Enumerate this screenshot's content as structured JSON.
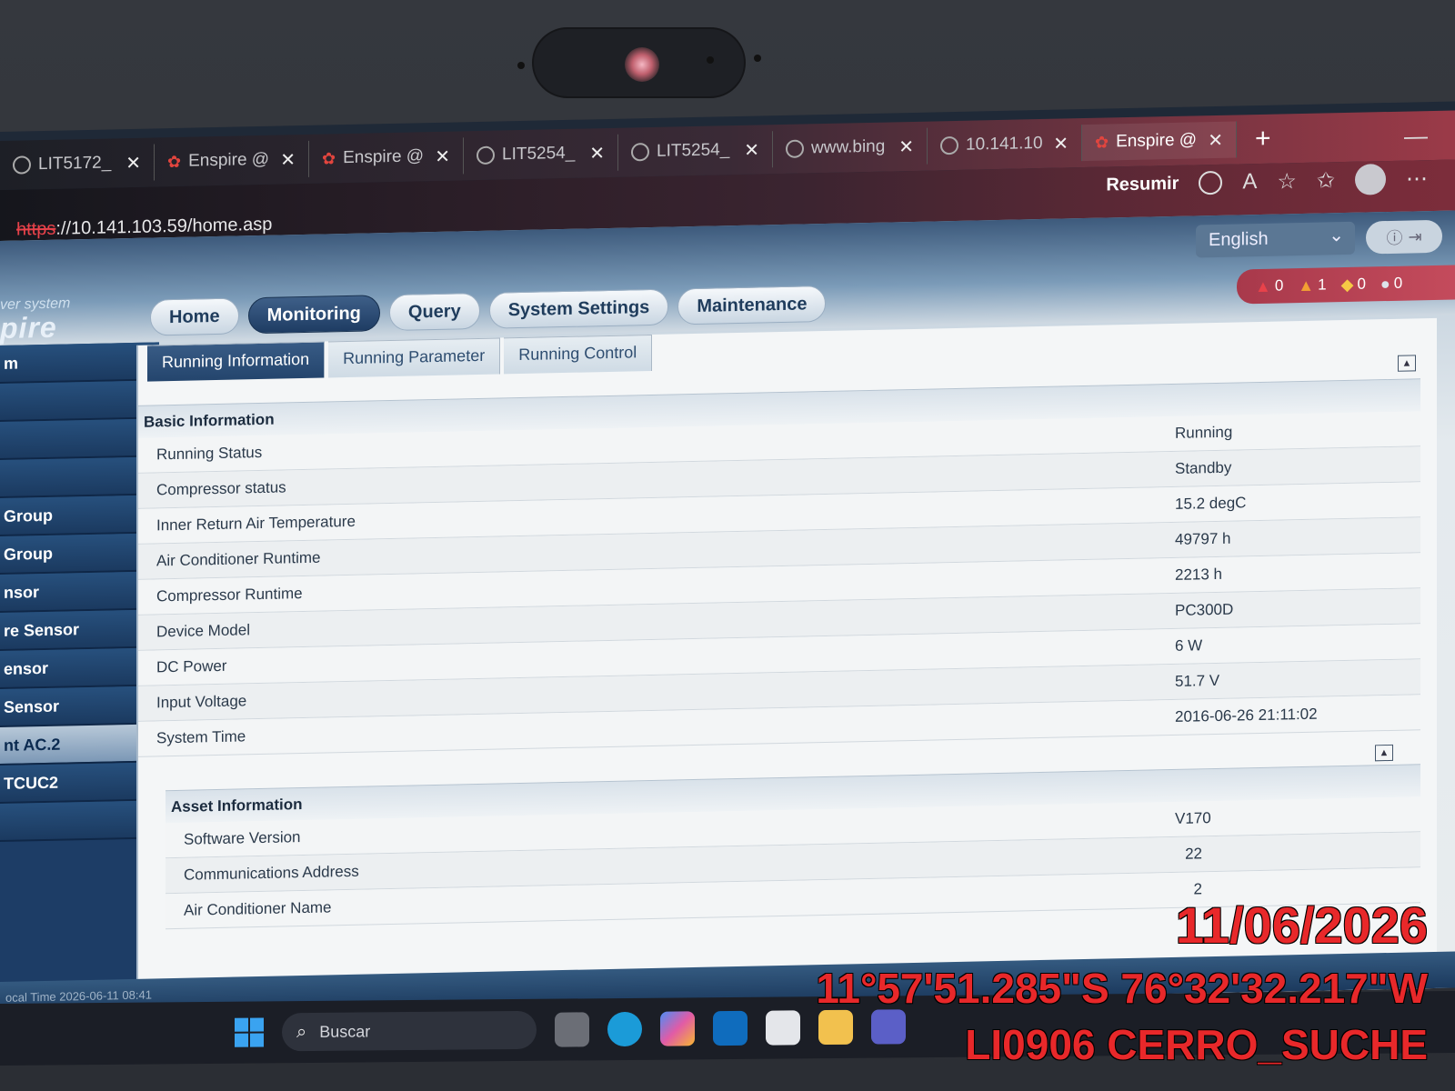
{
  "browser": {
    "tabs": [
      {
        "label": "LIT5172_",
        "icon": "globe-icon"
      },
      {
        "label": "Enspire @",
        "icon": "huawei-icon"
      },
      {
        "label": "Enspire @",
        "icon": "huawei-icon"
      },
      {
        "label": "LIT5254_",
        "icon": "globe-icon"
      },
      {
        "label": "LIT5254_",
        "icon": "globe-icon"
      },
      {
        "label": "www.bing",
        "icon": "page-blocked-icon"
      },
      {
        "label": "10.141.10",
        "icon": "page-blocked-icon"
      },
      {
        "label": "Enspire @",
        "icon": "huawei-icon"
      }
    ],
    "url_scheme": "https",
    "url_rest": "://10.141.103.59/home.asp",
    "resumir_label": "Resumir"
  },
  "app": {
    "logo_sub": "ver system",
    "logo_main": "pire",
    "language": "English",
    "alarms": [
      {
        "icon": "critical-alarm-icon",
        "count": "0",
        "color": "#e8424a"
      },
      {
        "icon": "major-alarm-icon",
        "count": "1",
        "color": "#f2a033"
      },
      {
        "icon": "minor-alarm-icon",
        "count": "0",
        "color": "#f6c945"
      },
      {
        "icon": "warning-alarm-icon",
        "count": "0",
        "color": "#dde3ea"
      }
    ],
    "nav": {
      "home": "Home",
      "monitoring": "Monitoring",
      "query": "Query",
      "system_settings": "System Settings",
      "maintenance": "Maintenance"
    },
    "sidebar": [
      "m",
      "",
      "",
      "",
      "Group",
      "Group",
      "nsor",
      "re Sensor",
      "ensor",
      " Sensor",
      "nt AC.2",
      " TCUC2",
      ""
    ],
    "subtabs": {
      "running_information": "Running Information",
      "running_parameter": "Running Parameter",
      "running_control": "Running Control"
    },
    "basic_info": {
      "title": "Basic Information",
      "rows": [
        {
          "label": "Running Status",
          "value": "Running"
        },
        {
          "label": "Compressor status",
          "value": "Standby"
        },
        {
          "label": "Inner Return Air Temperature",
          "value": "15.2  degC"
        },
        {
          "label": "Air Conditioner Runtime",
          "value": "49797  h"
        },
        {
          "label": "Compressor Runtime",
          "value": "2213  h"
        },
        {
          "label": "Device Model",
          "value": "PC300D"
        },
        {
          "label": "DC Power",
          "value": "6  W"
        },
        {
          "label": "Input Voltage",
          "value": "51.7  V"
        },
        {
          "label": "System Time",
          "value": "2016-06-26 21:11:02"
        }
      ]
    },
    "asset_info": {
      "title": "Asset Information",
      "rows": [
        {
          "label": "Software Version",
          "value": "V170"
        },
        {
          "label": "Communications Address",
          "value": "22"
        },
        {
          "label": "Air Conditioner Name",
          "value": "2"
        }
      ]
    },
    "status_strip": "ocal Time   2026-06-11 08:41"
  },
  "taskbar": {
    "search_placeholder": "Buscar",
    "apps": [
      "task-view-icon",
      "edge-icon",
      "copilot-icon",
      "outlook-icon",
      "store-icon",
      "explorer-icon",
      "teams-icon"
    ]
  },
  "photo_overlay": {
    "date": "11/06/2026",
    "coords": "11°57'51.285\"S 76°32'32.217\"W",
    "site": "LI0906 CERRO_SUCHE"
  }
}
